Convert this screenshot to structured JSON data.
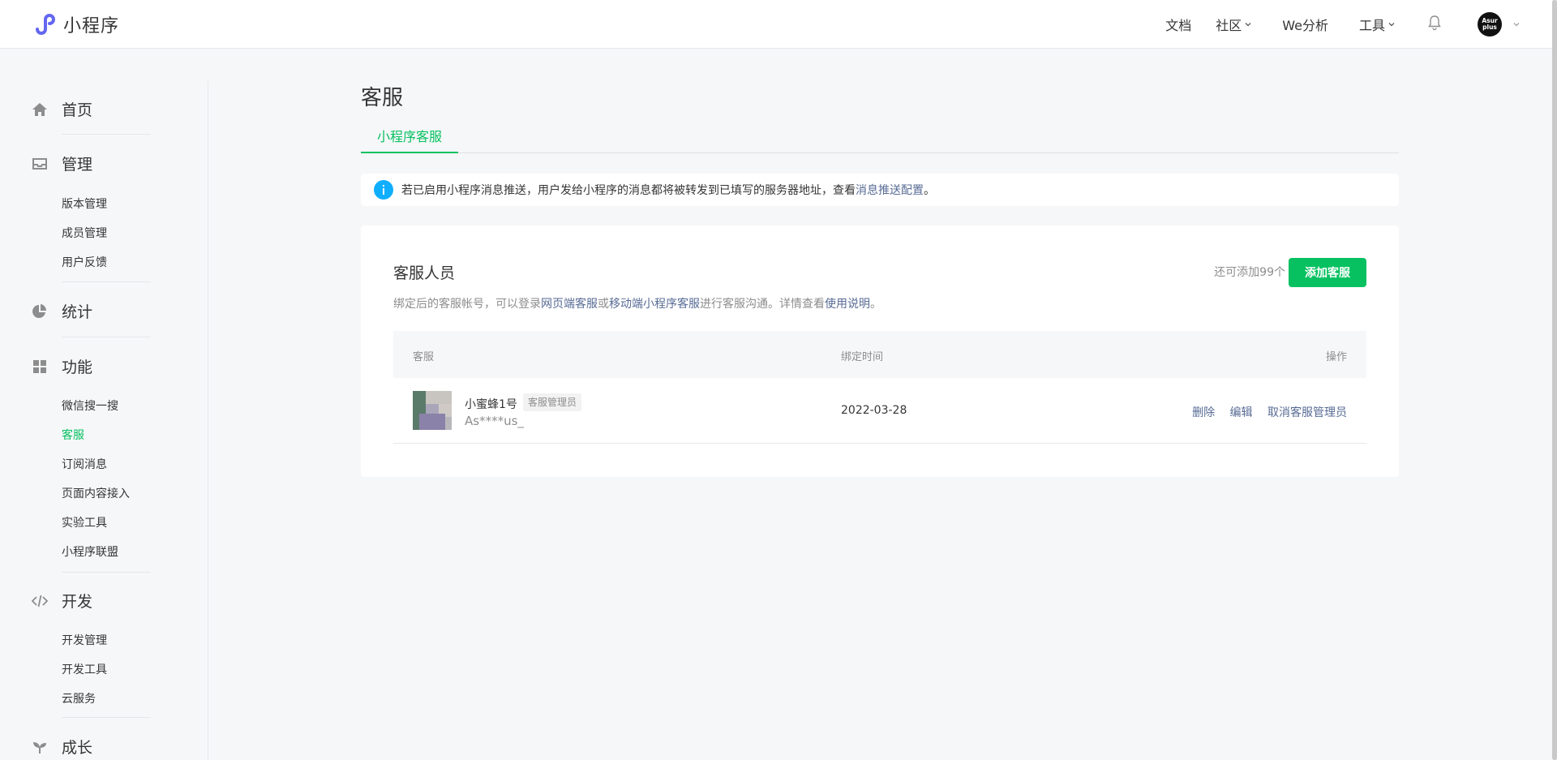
{
  "app": {
    "brand_name": "小程序",
    "brand_color": "#6467f0"
  },
  "topnav": {
    "docs": "文档",
    "community": "社区",
    "analytics": "We分析",
    "tools": "工具",
    "avatar_text_line1": "Asur",
    "avatar_text_line2": "plus"
  },
  "sidebar": {
    "sections": [
      {
        "label": "首页",
        "icon": "home-icon"
      },
      {
        "label": "管理",
        "icon": "inbox-icon",
        "items": [
          "版本管理",
          "成员管理",
          "用户反馈"
        ]
      },
      {
        "label": "统计",
        "icon": "pie-chart-icon"
      },
      {
        "label": "功能",
        "icon": "grid-icon",
        "items": [
          "微信搜一搜",
          "客服",
          "订阅消息",
          "页面内容接入",
          "实验工具",
          "小程序联盟"
        ]
      },
      {
        "label": "开发",
        "icon": "code-icon",
        "items": [
          "开发管理",
          "开发工具",
          "云服务"
        ]
      },
      {
        "label": "成长",
        "icon": "sprout-icon"
      }
    ],
    "active_item": "客服"
  },
  "main": {
    "title": "客服",
    "tab": "小程序客服",
    "notice": {
      "text": "若已启用小程序消息推送，用户发给小程序的消息都将被转发到已填写的服务器地址，查看 ",
      "link": "消息推送配置",
      "suffix": "。"
    },
    "card": {
      "title": "客服人员",
      "desc_prefix": "绑定后的客服帐号，可以登录",
      "desc_link1": "网页端客服",
      "desc_or": "或",
      "desc_link2": "移动端小程序客服",
      "desc_mid": "进行客服沟通。详情查看",
      "desc_link3": "使用说明",
      "desc_suffix": "。",
      "remaining": "还可添加99个",
      "add_button": "添加客服"
    },
    "table": {
      "headers": [
        "客服",
        "绑定时间",
        "操作"
      ],
      "rows": [
        {
          "name": "小蜜蜂1号",
          "role": "客服管理员",
          "account": "As****us_",
          "bind_time": "2022-03-28",
          "actions": [
            "删除",
            "编辑",
            "取消客服管理员"
          ]
        }
      ]
    }
  },
  "colors": {
    "accent_green": "#07c160",
    "link_blue": "#576b95",
    "info_blue": "#10aeff"
  }
}
